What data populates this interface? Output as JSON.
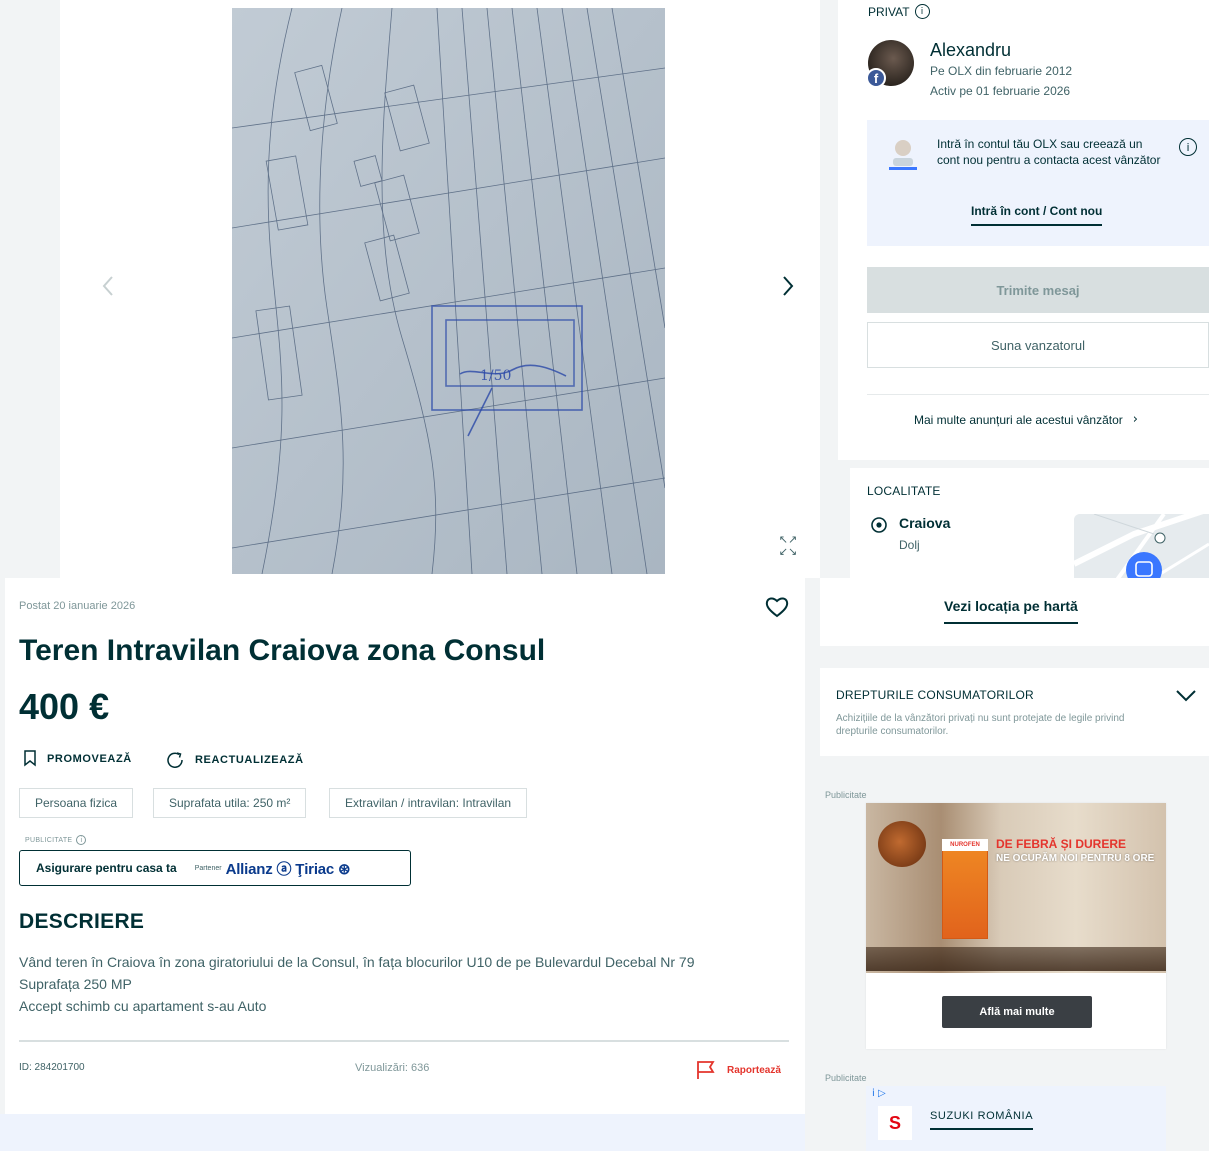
{
  "gallery": {
    "stamp_value": "1/50"
  },
  "seller": {
    "type_label": "PRIVAT",
    "name": "Alexandru",
    "since": "Pe OLX din februarie 2012",
    "active": "Activ pe 01 februarie 2026",
    "login_prompt": "Intră în contul tău OLX sau creează un cont nou pentru a contacta acest vânzător",
    "login_link": "Intră în cont / Cont nou",
    "message_button": "Trimite mesaj",
    "call_button": "Suna vanzatorul",
    "more_ads": "Mai multe anunțuri ale acestui vânzător"
  },
  "location": {
    "title": "LOCALITATE",
    "city": "Craiova",
    "region": "Dolj",
    "map_link": "Vezi locația pe hartă"
  },
  "ad": {
    "posted": "Postat 20 ianuarie 2026",
    "title": "Teren Intravilan Craiova zona Consul",
    "price": "400 €",
    "actions": {
      "promote": "PROMOVEAZĂ",
      "refresh": "REACTUALIZEAZĂ"
    },
    "tags": [
      "Persoana fizica",
      "Suprafata utila: 250 m²",
      "Extravilan / intravilan: Intravilan"
    ],
    "ad_label": "PUBLICITATE",
    "insurance_text": "Asigurare pentru casa ta",
    "insurance_partner": "Partener",
    "insurance_brand": "Allianz ⓐ Ţiriac ⊛",
    "description_title": "DESCRIERE",
    "description_lines": [
      "Vând teren în Craiova în zona giratoriului de la Consul, în fața blocurilor U10 de pe Bulevardul Decebal Nr 79",
      "Suprafața 250 MP",
      "Accept schimb cu apartament s-au Auto"
    ],
    "id": "ID: 284201700",
    "views": "Vizualizări: 636",
    "report": "Raportează"
  },
  "consumer": {
    "title": "DREPTURILE CONSUMATORILOR",
    "text": "Achizițiile de la vânzători privați nu sunt protejate de legile privind drepturile consumatorilor."
  },
  "ads_right": {
    "label": "Publicitate",
    "headline": "DE FEBRĂ ȘI DURERE",
    "sub": "NE OCUPĂM NOI PENTRU 8 ORE",
    "box_brand": "NUROFEN",
    "cta": "Află mai multe",
    "label2": "Publicitate",
    "marker": "i ▷",
    "brand2_logo": "S",
    "brand2": "SUZUKI ROMÂNIA"
  },
  "icons": {
    "nav_prev": "chevron-left-icon",
    "nav_next": "chevron-right-icon",
    "fullscreen": "expand-icon",
    "heart": "heart-icon",
    "report": "flag-icon"
  },
  "colors": {
    "primary": "#002f34",
    "accent_red": "#e4352d",
    "muted": "#406367",
    "page_bg": "#f2f4f5",
    "login_box": "#eef3fd"
  }
}
